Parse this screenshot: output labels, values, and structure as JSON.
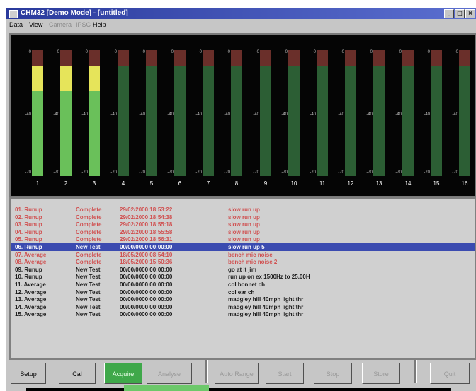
{
  "window": {
    "title": "CHM32 [Demo Mode] - [untitled]"
  },
  "menu": [
    {
      "label": "Data",
      "enabled": true
    },
    {
      "label": "View",
      "enabled": true
    },
    {
      "label": "Camera",
      "enabled": false
    },
    {
      "label": "IPSC",
      "enabled": false
    },
    {
      "label": "Help",
      "enabled": true
    }
  ],
  "meters": {
    "scale": {
      "top": "0",
      "mid": "-40",
      "bottom": "-70"
    },
    "channels": [
      {
        "label": "1",
        "level": 0.85
      },
      {
        "label": "2",
        "level": 0.85
      },
      {
        "label": "3",
        "level": 0.85
      },
      {
        "label": "4",
        "level": 0
      },
      {
        "label": "5",
        "level": 0
      },
      {
        "label": "6",
        "level": 0
      },
      {
        "label": "7",
        "level": 0
      },
      {
        "label": "8",
        "level": 0
      },
      {
        "label": "9",
        "level": 0
      },
      {
        "label": "10",
        "level": 0
      },
      {
        "label": "11",
        "level": 0
      },
      {
        "label": "12",
        "level": 0
      },
      {
        "label": "13",
        "level": 0
      },
      {
        "label": "14",
        "level": 0
      },
      {
        "label": "15",
        "level": 0
      },
      {
        "label": "16",
        "level": 0
      }
    ]
  },
  "tests": [
    {
      "name": "01. Runup",
      "status": "Complete",
      "date": "29/02/2000 18:53:22",
      "desc": "slow run up",
      "style": "red"
    },
    {
      "name": "02. Runup",
      "status": "Complete",
      "date": "29/02/2000 18:54:38",
      "desc": "slow run up",
      "style": "red"
    },
    {
      "name": "03. Runup",
      "status": "Complete",
      "date": "29/02/2000 18:55:18",
      "desc": "slow run up",
      "style": "red"
    },
    {
      "name": "04. Runup",
      "status": "Complete",
      "date": "29/02/2000 18:55:58",
      "desc": "slow run up",
      "style": "red"
    },
    {
      "name": "05. Runup",
      "status": "Complete",
      "date": "29/02/2000 18:56:31",
      "desc": "slow run up",
      "style": "red"
    },
    {
      "name": "06. Runup",
      "status": "New Test",
      "date": "00/00/0000 00:00:00",
      "desc": "slow run up 5",
      "style": "selected"
    },
    {
      "name": "07. Average",
      "status": "Complete",
      "date": "18/05/2000 08:54:10",
      "desc": "bench mic noise",
      "style": "red"
    },
    {
      "name": "08. Average",
      "status": "Complete",
      "date": "18/05/2000 15:50:36",
      "desc": "bench mic noise 2",
      "style": "red"
    },
    {
      "name": "09. Runup",
      "status": "New Test",
      "date": "00/00/0000 00:00:00",
      "desc": "go at it jim",
      "style": "black"
    },
    {
      "name": "10. Runup",
      "status": "New Test",
      "date": "00/00/0000 00:00:00",
      "desc": "run up on ex 1500Hz to 25.00H",
      "style": "black"
    },
    {
      "name": "11. Average",
      "status": "New Test",
      "date": "00/00/0000 00:00:00",
      "desc": "col bonnet ch",
      "style": "black"
    },
    {
      "name": "12. Average",
      "status": "New Test",
      "date": "00/00/0000 00:00:00",
      "desc": "col ear ch",
      "style": "black"
    },
    {
      "name": "13. Average",
      "status": "New Test",
      "date": "00/00/0000 00:00:00",
      "desc": "madgley hill 40mph light thr",
      "style": "black"
    },
    {
      "name": "14. Average",
      "status": "New Test",
      "date": "00/00/0000 00:00:00",
      "desc": "madgley hill 40mph light thr",
      "style": "black"
    },
    {
      "name": "15. Average",
      "status": "New Test",
      "date": "00/00/0000 00:00:00",
      "desc": "madgley hill 40mph light thr",
      "style": "black"
    }
  ],
  "toolbar": {
    "setup": "Setup",
    "cal": "Cal",
    "acquire": "Acquire",
    "analyse": "Analyse",
    "auto_range": "Auto Range",
    "start": "Start",
    "stop": "Stop",
    "store": "Store",
    "quit": "Quit"
  },
  "colors": {
    "title_bar": "#2a3a9c",
    "selection": "#3b4bb0",
    "complete_text": "#d05050",
    "acquire_active": "#3fa84a",
    "meter_green": "#3f8a3f",
    "meter_yellow": "#dcd84a",
    "meter_red": "#6a2f2a"
  }
}
